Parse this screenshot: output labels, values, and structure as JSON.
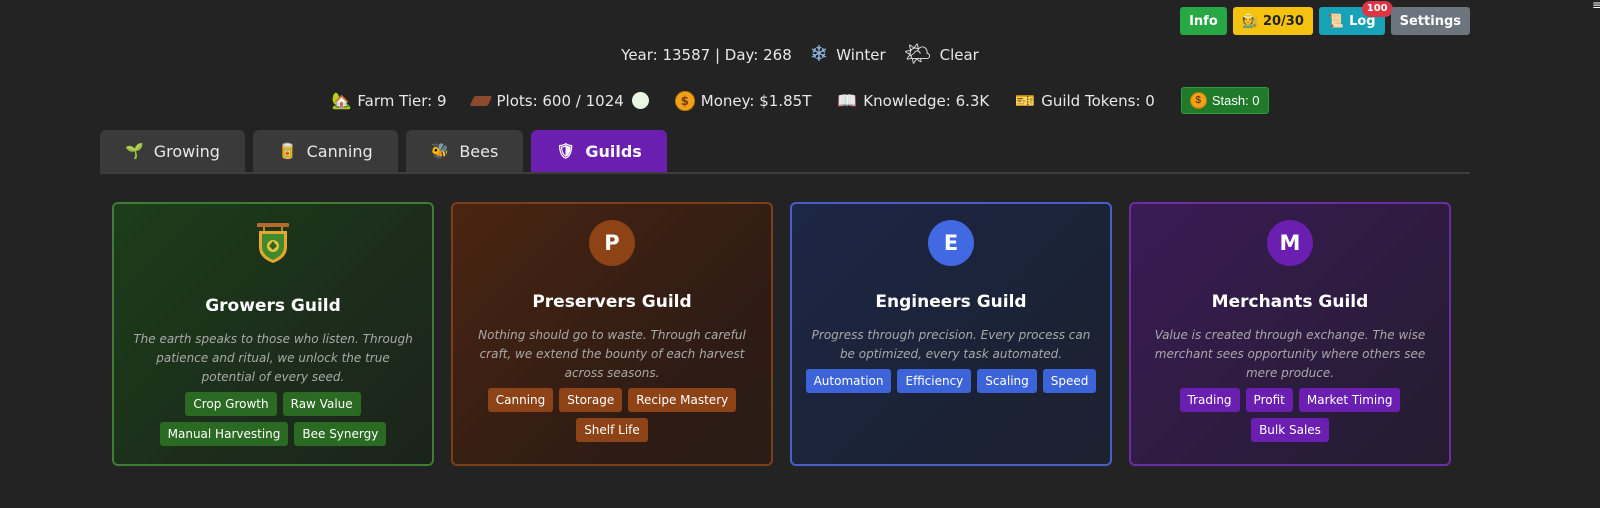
{
  "top_buttons": {
    "info": "Info",
    "stamina": "20/30",
    "log": "Log",
    "log_badge": "100",
    "settings": "Settings"
  },
  "date": {
    "text": "Year: 13587 | Day: 268",
    "season": "Winter",
    "weather": "Clear"
  },
  "stats": {
    "farm_tier": "Farm Tier: 9",
    "plots": "Plots: 600 / 1024",
    "money": "Money: $1.85T",
    "knowledge": "Knowledge: 6.3K",
    "guild_tokens": "Guild Tokens: 0",
    "stash": "Stash: 0"
  },
  "tabs": [
    {
      "label": "Growing",
      "icon": "sprout-icon"
    },
    {
      "label": "Canning",
      "icon": "jar-icon"
    },
    {
      "label": "Bees",
      "icon": "bee-icon"
    },
    {
      "label": "Guilds",
      "icon": "shield-icon",
      "active": true
    }
  ],
  "guilds": [
    {
      "name": "Growers Guild",
      "emblem": "",
      "desc": "The earth speaks to those who listen. Through patience and ritual, we unlock the true potential of every seed.",
      "tags": [
        "Crop Growth",
        "Raw Value",
        "Manual Harvesting",
        "Bee Synergy"
      ],
      "color": "#2b6a22"
    },
    {
      "name": "Preservers Guild",
      "emblem": "P",
      "desc": "Nothing should go to waste. Through careful craft, we extend the bounty of each harvest across seasons.",
      "tags": [
        "Canning",
        "Storage",
        "Recipe Mastery",
        "Shelf Life"
      ],
      "color": "#8d4316"
    },
    {
      "name": "Engineers Guild",
      "emblem": "E",
      "desc": "Progress through precision. Every process can be optimized, every task automated.",
      "tags": [
        "Automation",
        "Efficiency",
        "Scaling",
        "Speed"
      ],
      "color": "#3c64d8"
    },
    {
      "name": "Merchants Guild",
      "emblem": "M",
      "desc": "Value is created through exchange. The wise merchant sees opportunity where others see mere produce.",
      "tags": [
        "Trading",
        "Profit",
        "Market Timing",
        "Bulk Sales"
      ],
      "color": "#6a1fb0"
    }
  ]
}
